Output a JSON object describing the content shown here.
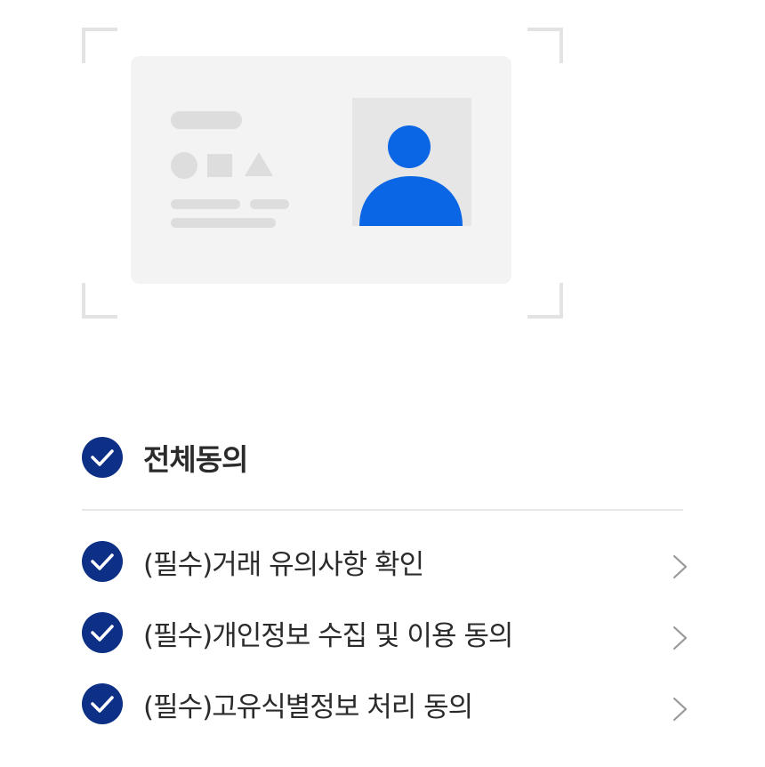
{
  "illustration": {
    "icon": "id-card-illustration",
    "accent_color": "#0a66e4",
    "card_color": "#f3f3f3",
    "placeholder_color": "#dddddd",
    "frame_color": "#e3e3e3"
  },
  "agreement": {
    "all_label": "전체동의",
    "all_checked": true,
    "check_color": "#0d2f86",
    "items": [
      {
        "label": "(필수)거래 유의사항 확인",
        "checked": true,
        "icon": "chevron-right-icon"
      },
      {
        "label": "(필수)개인정보 수집 및 이용 동의",
        "checked": true,
        "icon": "chevron-right-icon"
      },
      {
        "label": "(필수)고유식별정보 처리 동의",
        "checked": true,
        "icon": "chevron-right-icon"
      }
    ]
  }
}
